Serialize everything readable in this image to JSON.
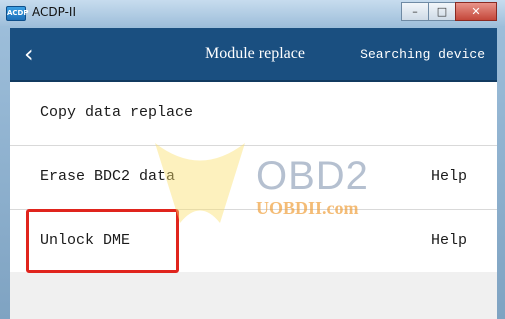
{
  "window": {
    "title": "ACDP-II",
    "icon_text": "ACDP"
  },
  "window_controls": {
    "minimize": "–",
    "maximize": "□",
    "close": "✕"
  },
  "header": {
    "back_icon": "‹",
    "title": "Module replace",
    "status": "Searching device"
  },
  "menu": {
    "items": [
      {
        "label": "Copy data replace",
        "help": ""
      },
      {
        "label": "Erase BDC2 data",
        "help": "Help"
      },
      {
        "label": "Unlock DME",
        "help": "Help"
      }
    ]
  },
  "watermark": {
    "brand": "OBD2",
    "site": "UOBDII.com"
  },
  "colors": {
    "header": "#1a4f80",
    "highlight": "#e0241d"
  }
}
